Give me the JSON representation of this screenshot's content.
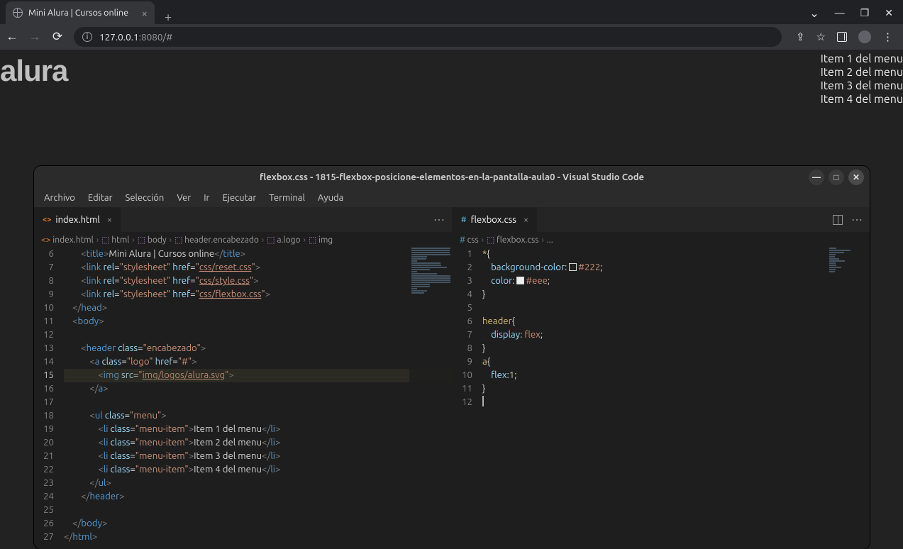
{
  "browser": {
    "tab_title": "Mini Alura | Cursos online",
    "url_host": "127.0.0.1",
    "url_rest": ":8080/#"
  },
  "page": {
    "logo_text": "alura",
    "menu": [
      "Item 1 del menu",
      "Item 2 del menu",
      "Item 3 del menu",
      "Item 4 del menu"
    ]
  },
  "vscode": {
    "title": "flexbox.css - 1815-flexbox-posicione-elementos-en-la-pantalla-aula0 - Visual Studio Code",
    "menus": [
      "Archivo",
      "Editar",
      "Selección",
      "Ver",
      "Ir",
      "Ejecutar",
      "Terminal",
      "Ayuda"
    ],
    "left": {
      "tab": "index.html",
      "breadcrumb": [
        "index.html",
        "html",
        "body",
        "header.encabezado",
        "a.logo",
        "img"
      ],
      "line_start": 6,
      "current_line": 15,
      "lines_html": [
        "        <span class='t-br'>&lt;</span><span class='t-tag'>title</span><span class='t-br'>&gt;</span><span class='t-txt'>Mini Alura | Cursos online</span><span class='t-br'>&lt;/</span><span class='t-tag'>title</span><span class='t-br'>&gt;</span>",
        "        <span class='t-br'>&lt;</span><span class='t-tag'>link</span> <span class='t-attr'>rel</span>=<span class='t-str'>\"stylesheet\"</span> <span class='t-attr'>href</span>=<span class='t-str'>\"</span><span class='t-link'>css/reset.css</span><span class='t-str'>\"</span><span class='t-br'>&gt;</span>",
        "        <span class='t-br'>&lt;</span><span class='t-tag'>link</span> <span class='t-attr'>rel</span>=<span class='t-str'>\"stylesheet\"</span> <span class='t-attr'>href</span>=<span class='t-str'>\"</span><span class='t-link'>css/style.css</span><span class='t-str'>\"</span><span class='t-br'>&gt;</span>",
        "        <span class='t-br'>&lt;</span><span class='t-tag'>link</span> <span class='t-attr'>rel</span>=<span class='t-str'>\"stylesheet\"</span> <span class='t-attr'>href</span>=<span class='t-str'>\"</span><span class='t-link'>css/flexbox.css</span><span class='t-str'>\"</span><span class='t-br'>&gt;</span>",
        "    <span class='t-br'>&lt;/</span><span class='t-tag'>head</span><span class='t-br'>&gt;</span>",
        "    <span class='t-br'>&lt;</span><span class='t-tag'>body</span><span class='t-br'>&gt;</span>",
        "",
        "        <span class='t-br'>&lt;</span><span class='t-tag'>header</span> <span class='t-attr'>class</span>=<span class='t-str'>\"encabezado\"</span><span class='t-br'>&gt;</span>",
        "            <span class='t-br'>&lt;</span><span class='t-tag'>a</span> <span class='t-attr'>class</span>=<span class='t-str'>\"logo\"</span> <span class='t-attr'>href</span>=<span class='t-str'>\"#\"</span><span class='t-br'>&gt;</span>",
        "                <span class='t-br'>&lt;</span><span class='t-tag'>img</span> <span class='t-attr'>src</span>=<span class='t-str'>\"</span><span class='t-link'>img/logos/alura.svg</span><span class='t-str'>\"</span><span class='t-br'>&gt;</span>",
        "            <span class='t-br'>&lt;/</span><span class='t-tag'>a</span><span class='t-br'>&gt;</span>",
        "",
        "            <span class='t-br'>&lt;</span><span class='t-tag'>ul</span> <span class='t-attr'>class</span>=<span class='t-str'>\"menu\"</span><span class='t-br'>&gt;</span>",
        "                <span class='t-br'>&lt;</span><span class='t-tag'>li</span> <span class='t-attr'>class</span>=<span class='t-str'>\"menu-item\"</span><span class='t-br'>&gt;</span><span class='t-txt'>Item 1 del menu</span><span class='t-br'>&lt;/</span><span class='t-tag'>li</span><span class='t-br'>&gt;</span>",
        "                <span class='t-br'>&lt;</span><span class='t-tag'>li</span> <span class='t-attr'>class</span>=<span class='t-str'>\"menu-item\"</span><span class='t-br'>&gt;</span><span class='t-txt'>Item 2 del menu</span><span class='t-br'>&lt;/</span><span class='t-tag'>li</span><span class='t-br'>&gt;</span>",
        "                <span class='t-br'>&lt;</span><span class='t-tag'>li</span> <span class='t-attr'>class</span>=<span class='t-str'>\"menu-item\"</span><span class='t-br'>&gt;</span><span class='t-txt'>Item 3 del menu</span><span class='t-br'>&lt;/</span><span class='t-tag'>li</span><span class='t-br'>&gt;</span>",
        "                <span class='t-br'>&lt;</span><span class='t-tag'>li</span> <span class='t-attr'>class</span>=<span class='t-str'>\"menu-item\"</span><span class='t-br'>&gt;</span><span class='t-txt'>Item 4 del menu</span><span class='t-br'>&lt;/</span><span class='t-tag'>li</span><span class='t-br'>&gt;</span>",
        "            <span class='t-br'>&lt;/</span><span class='t-tag'>ul</span><span class='t-br'>&gt;</span>",
        "        <span class='t-br'>&lt;/</span><span class='t-tag'>header</span><span class='t-br'>&gt;</span>",
        "",
        "    <span class='t-br'>&lt;/</span><span class='t-tag'>body</span><span class='t-br'>&gt;</span>",
        "<span class='t-br'>&lt;/</span><span class='t-tag'>html</span><span class='t-br'>&gt;</span>"
      ]
    },
    "right": {
      "tab": "flexbox.css",
      "breadcrumb": [
        "css",
        "flexbox.css",
        "..."
      ],
      "line_start": 1,
      "lines_html": [
        "<span class='t-sel'>*</span><span class='t-punc'>{</span>",
        "    <span class='t-prop'>background-color</span><span class='t-punc'>:</span> <span class='swatch' style='background:#222'></span><span class='t-val'>#222</span><span class='t-punc'>;</span>",
        "    <span class='t-prop'>color</span><span class='t-punc'>:</span> <span class='swatch' style='background:#eee'></span><span class='t-val'>#eee</span><span class='t-punc'>;</span>",
        "<span class='t-punc'>}</span>",
        "",
        "<span class='t-sel'>header</span><span class='t-punc'>{</span>",
        "    <span class='t-prop'>display</span><span class='t-punc'>:</span> <span class='t-val'>flex</span><span class='t-punc'>;</span>",
        "<span class='t-punc'>}</span>",
        "<span class='t-sel'>a</span><span class='t-punc'>{</span>",
        "    <span class='t-prop'>flex</span><span class='t-punc'>:</span><span class='t-num'>1</span><span class='t-punc'>;</span>",
        "<span class='t-punc'>}</span>",
        "<span class='cursor'></span>"
      ]
    }
  }
}
